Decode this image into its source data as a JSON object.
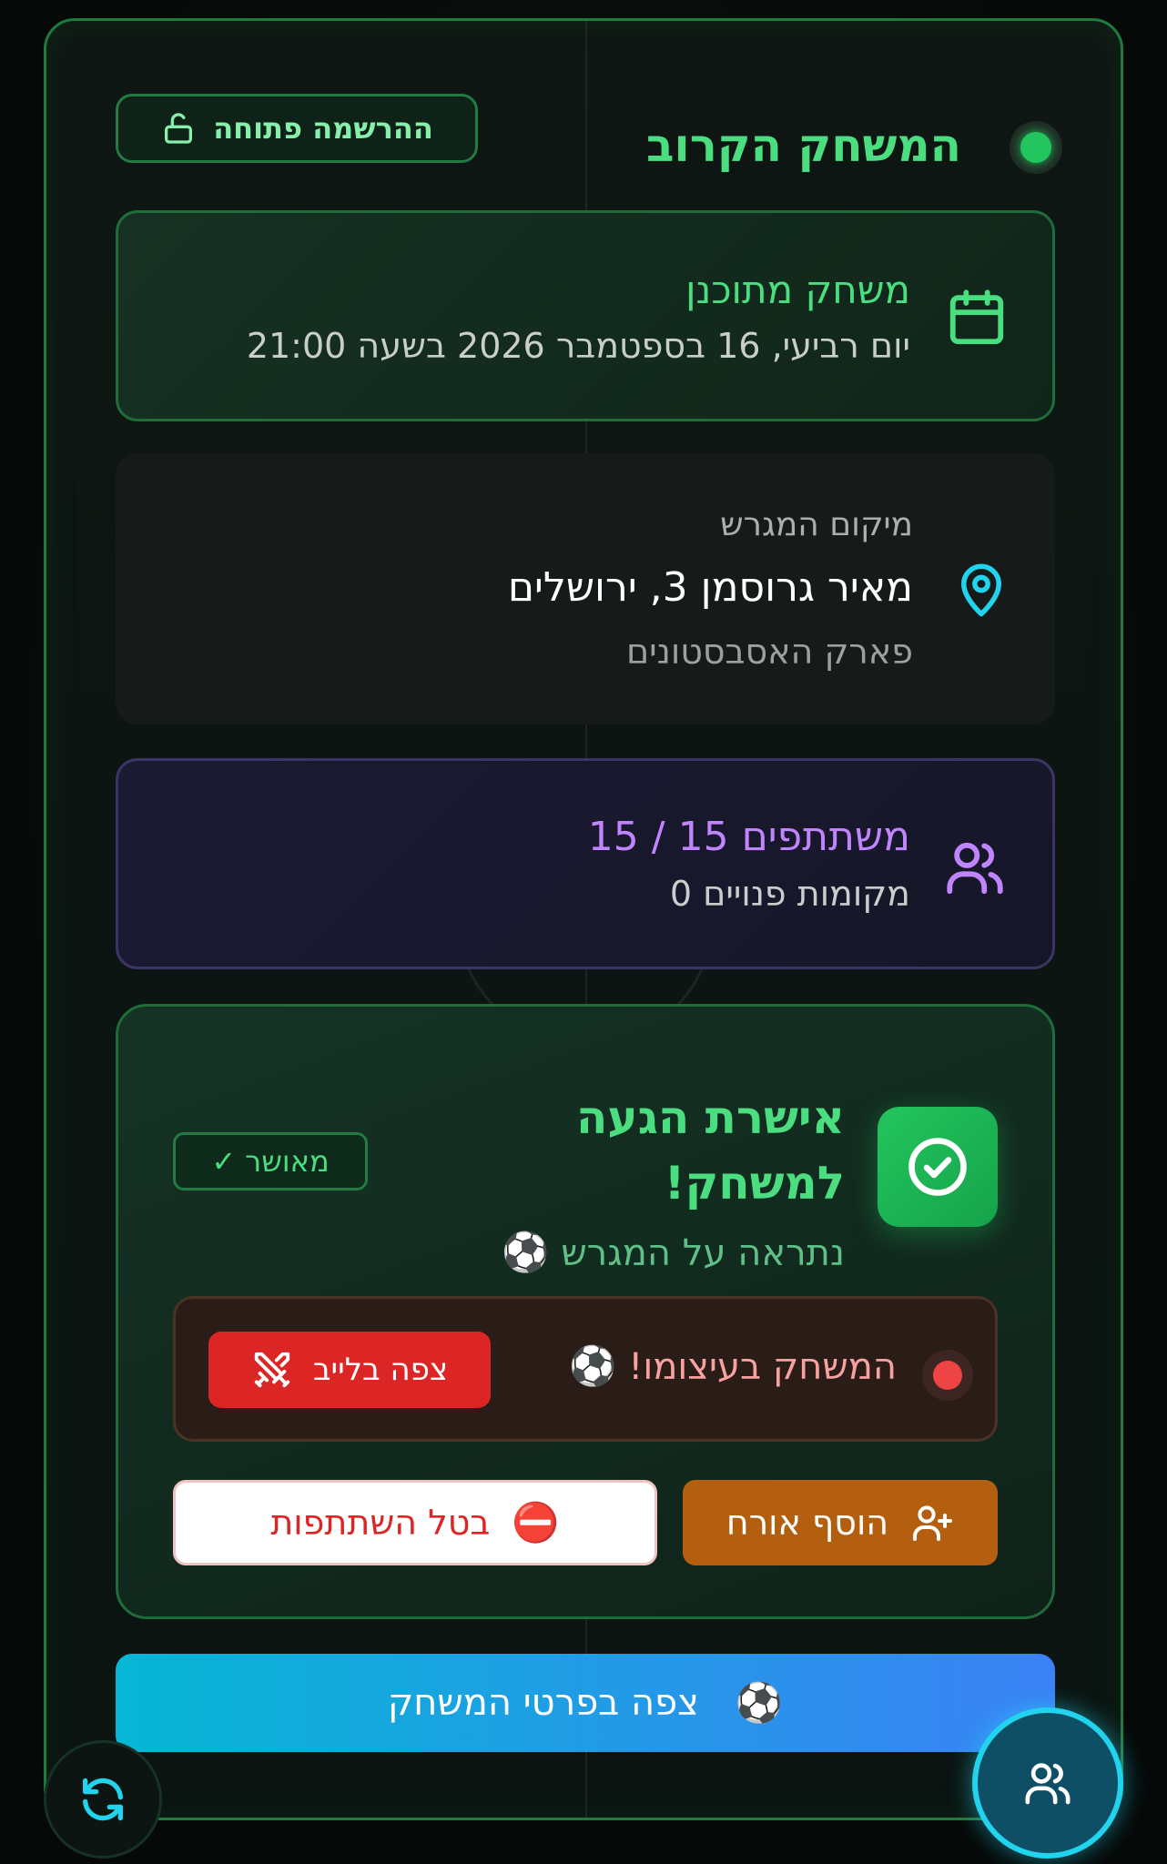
{
  "header": {
    "title": "המשחק הקרוב",
    "registration_badge": "ההרשמה פתוחה"
  },
  "game": {
    "title": "משחק מתוכנן",
    "datetime": "יום רביעי, 16 בספטמבר 2026 בשעה 21:00"
  },
  "location": {
    "label": "מיקום המגרש",
    "address": "מאיר גרוסמן 3, ירושלים",
    "park": "פארק האסבסטונים"
  },
  "participants": {
    "title": "משתתפים 15 / 15",
    "free_spots": "מקומות פנויים 0"
  },
  "confirmation": {
    "title": "אישרת הגעה למשחק!",
    "subtitle": "נתראה על המגרש",
    "status_badge": "מאושר",
    "live_status": "המשחק בעיצומו!",
    "watch_live_label": "צפה בלייב",
    "add_guest_label": "הוסף אורח",
    "cancel_label": "בטל השתתפות"
  },
  "details_button": {
    "label": "צפה בפרטי המשחק"
  },
  "icons": {
    "soccer_ball": "⚽",
    "no_entry": "⛔",
    "check": "✓"
  },
  "colors": {
    "accent_green": "#4ade80",
    "live_red": "#ef4444",
    "participants_purple": "#c084fc",
    "location_cyan": "#22d3ee",
    "guest_orange": "#b45f0f",
    "details_gradient_start": "#06b6d4",
    "details_gradient_end": "#3b82f6"
  }
}
